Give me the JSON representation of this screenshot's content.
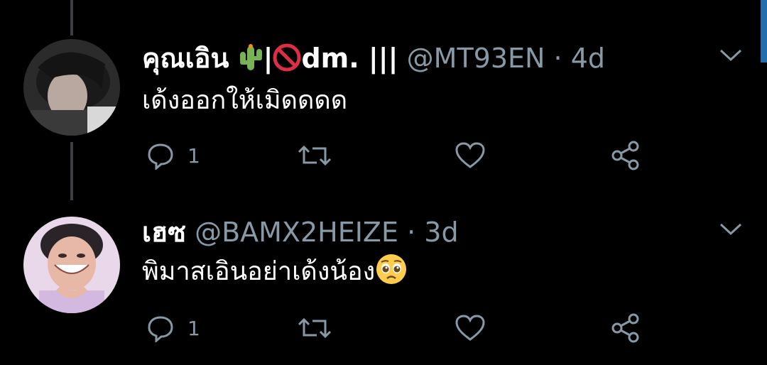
{
  "tweets": [
    {
      "display_name": "คุณเอิน",
      "name_suffix": "dm. |||",
      "handle": "@MT93EN",
      "separator": "·",
      "time": "4d",
      "text": "เด้งออกให้เมิดดดด",
      "reply_count": "1"
    },
    {
      "display_name": "เฮซ",
      "handle": "@BAMX2HEIZE",
      "separator": "·",
      "time": "3d",
      "text": "พิมาสเอินอย่าเด้งน้อง",
      "reply_count": "1"
    }
  ],
  "icons": {
    "reply": "reply-icon",
    "retweet": "retweet-icon",
    "like": "heart-icon",
    "share": "share-icon",
    "menu": "chevron-down-icon"
  },
  "colors": {
    "background": "#000000",
    "secondary_text": "#8899a6",
    "thread_line": "#3a3f45"
  }
}
